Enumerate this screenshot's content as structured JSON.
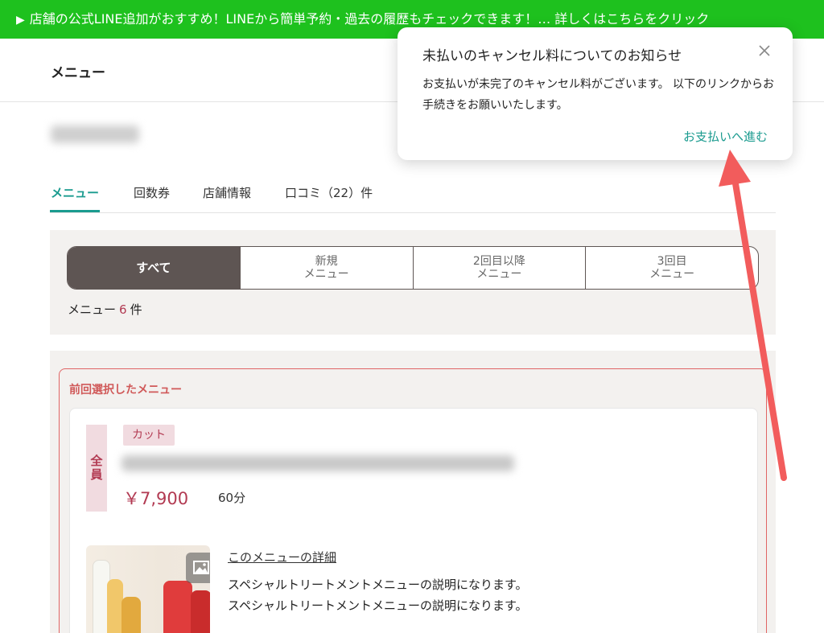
{
  "banner": {
    "arrow": "▶",
    "text": "店舗の公式LINE追加がおすすめ！LINEから簡単予約・過去の履歴もチェックできます！… 詳しくはこちらをクリック"
  },
  "header": {
    "title": "メニュー"
  },
  "tabs": [
    {
      "label": "メニュー",
      "active": true
    },
    {
      "label": "回数券"
    },
    {
      "label": "店舗情報"
    },
    {
      "label": "口コミ（22）件"
    }
  ],
  "filters": {
    "segments": [
      {
        "line1": "すべて",
        "line2": ""
      },
      {
        "line1": "新規",
        "line2": "メニュー"
      },
      {
        "line1": "2回目以降",
        "line2": "メニュー"
      },
      {
        "line1": "3回目",
        "line2": "メニュー"
      }
    ],
    "count_prefix": "メニュー",
    "count": "6",
    "count_suffix": "件"
  },
  "previous": {
    "label": "前回選択したメニュー",
    "badge": "全員",
    "category": "カット",
    "price": "￥7,900",
    "duration": "60分",
    "detail_link": "このメニューの詳細",
    "desc_1": "スペシャルトリートメントメニューの説明になります。",
    "desc_2": "スペシャルトリートメントメニューの説明になります。"
  },
  "popup": {
    "title": "未払いのキャンセル料についてのお知らせ",
    "body": "お支払いが未完了のキャンセル料がございます。 以下のリンクからお手続きをお願いいたします。",
    "link": "お支払いへ進む"
  },
  "colors": {
    "banner": "#1ec11e",
    "accent": "#1a9b8f",
    "brand": "#5e5553",
    "price": "#b23a52",
    "annotation_arrow": "#f25c5c"
  }
}
